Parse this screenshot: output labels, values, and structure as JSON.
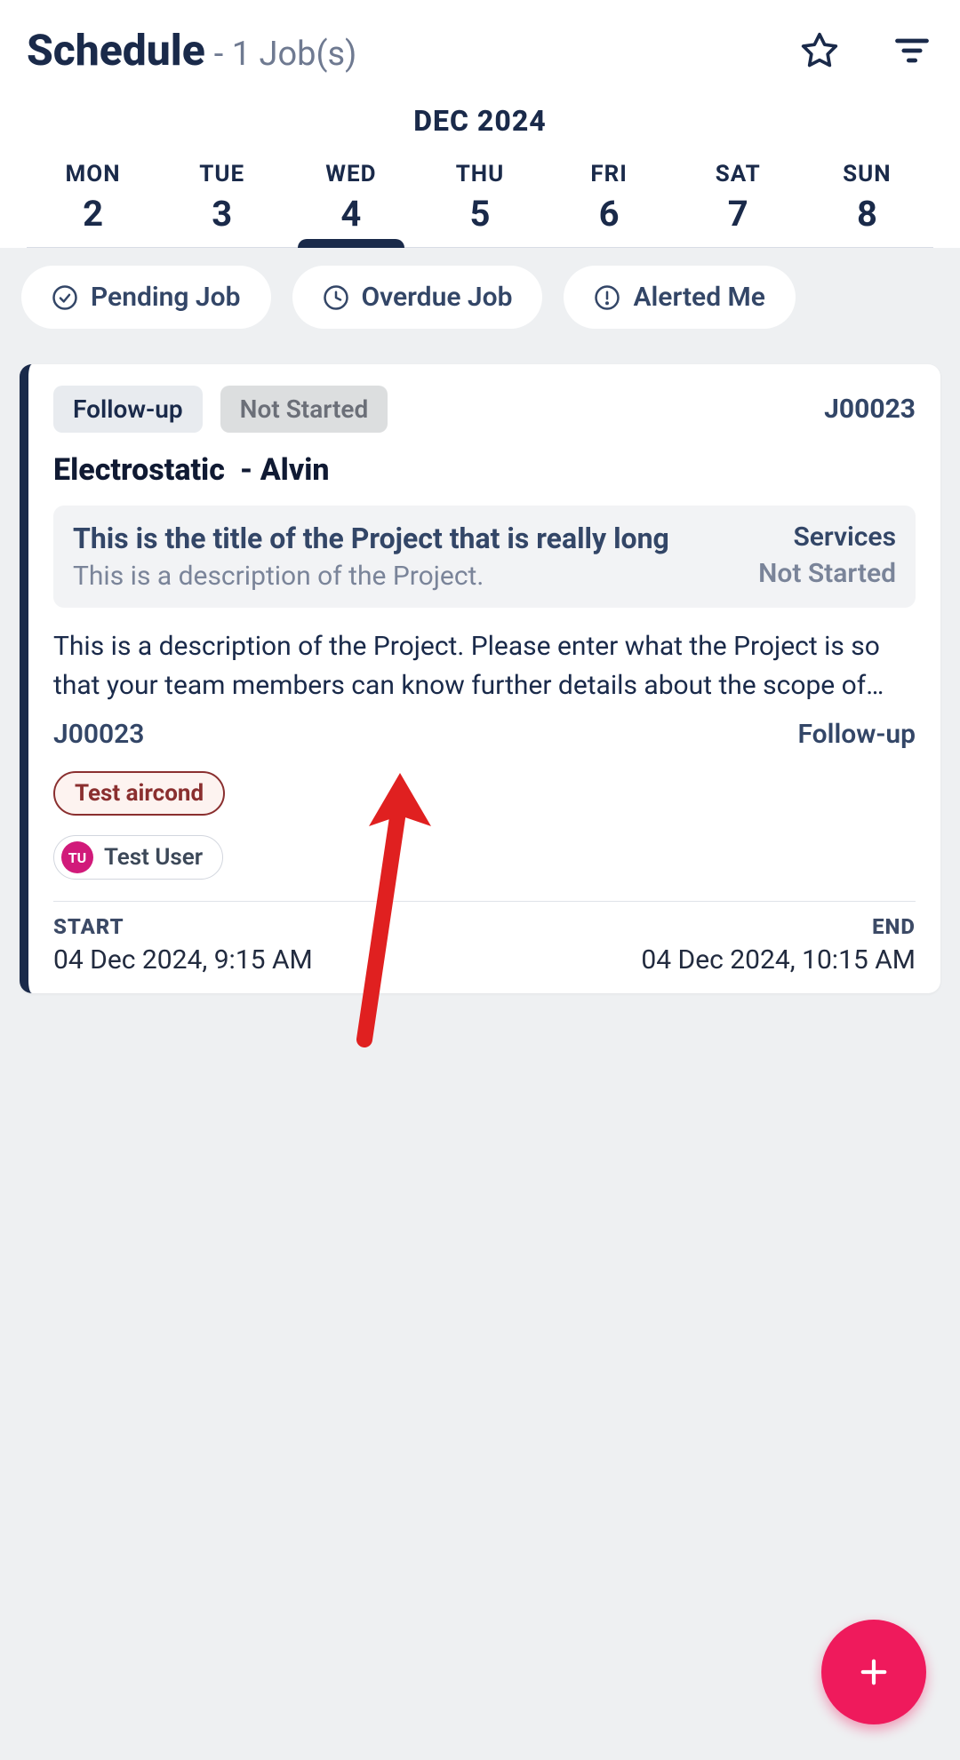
{
  "header": {
    "title": "Schedule",
    "subtitle": "- 1 Job(s)"
  },
  "calendar": {
    "month_label": "DEC 2024",
    "selected_index": 2,
    "days": [
      {
        "name": "MON",
        "num": "2"
      },
      {
        "name": "TUE",
        "num": "3"
      },
      {
        "name": "WED",
        "num": "4"
      },
      {
        "name": "THU",
        "num": "5"
      },
      {
        "name": "FRI",
        "num": "6"
      },
      {
        "name": "SAT",
        "num": "7"
      },
      {
        "name": "SUN",
        "num": "8"
      }
    ]
  },
  "filters": {
    "pending": "Pending Job",
    "overdue": "Overdue Job",
    "alerted": "Alerted Me"
  },
  "job": {
    "badge_type": "Follow-up",
    "badge_status": "Not Started",
    "id": "J00023",
    "customer": "Electrostatic",
    "contact": "Alvin",
    "sub_title": "This is the title of the Project that is really long",
    "sub_desc": "This is a description of the Project.",
    "sub_service": "Services",
    "sub_status": "Not Started",
    "project_desc": "This is a description of the Project. Please enter what the Project is so that your team members can know further details about the scope of work.",
    "id_repeat": "J00023",
    "type_repeat": "Follow-up",
    "tag": "Test aircond",
    "user_initials": "TU",
    "user_name": "Test User",
    "start_label": "START",
    "start_value": "04 Dec 2024, 9:15 AM",
    "end_label": "END",
    "end_value": "04 Dec 2024, 10:15 AM"
  }
}
